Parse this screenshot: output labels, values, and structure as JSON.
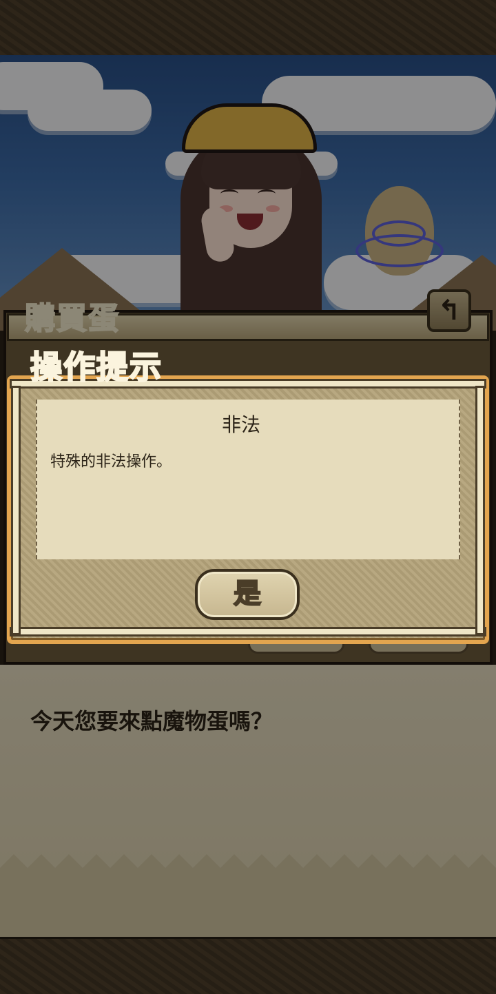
{
  "buy_panel": {
    "title": "購買蛋",
    "back_icon": "back-arrow-icon"
  },
  "dialog": {
    "title": "操作提示",
    "message_title": "非法",
    "message_body": "特殊的非法操作。",
    "confirm_label": "是"
  },
  "npc": {
    "dialogue": "今天您要來點魔物蛋嗎？"
  },
  "colors": {
    "dialog_border": "#e3a54f",
    "paper": "#e6dcbc",
    "text": "#2c2418"
  }
}
